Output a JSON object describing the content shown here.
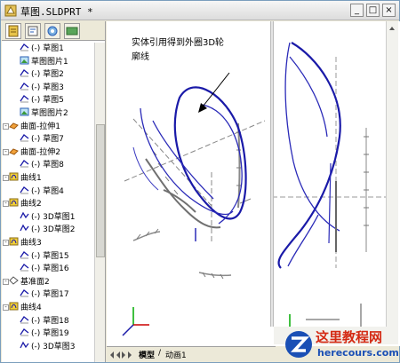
{
  "window": {
    "title": "草图.SLDPRT *",
    "minimize_label": "_",
    "restore_label": "□",
    "close_label": "×"
  },
  "feature_tree": [
    {
      "label": "草图1",
      "prefix": "(-)",
      "icon": "sketch-icon"
    },
    {
      "label": "草图图片1",
      "prefix": "",
      "icon": "sketch-picture-icon"
    },
    {
      "label": "草图2",
      "prefix": "(-)",
      "icon": "sketch-icon"
    },
    {
      "label": "草图3",
      "prefix": "(-)",
      "icon": "sketch-icon"
    },
    {
      "label": "草图5",
      "prefix": "(-)",
      "icon": "sketch-icon"
    },
    {
      "label": "草图图片2",
      "prefix": "",
      "icon": "sketch-picture-icon"
    },
    {
      "label": "曲面-拉伸1",
      "prefix": "",
      "icon": "surface-extrude-icon"
    },
    {
      "label": "草图7",
      "prefix": "(-)",
      "icon": "sketch-icon"
    },
    {
      "label": "曲面-拉伸2",
      "prefix": "",
      "icon": "surface-extrude-icon"
    },
    {
      "label": "草图8",
      "prefix": "(-)",
      "icon": "sketch-icon"
    },
    {
      "label": "曲线1",
      "prefix": "",
      "icon": "curve-icon"
    },
    {
      "label": "草图4",
      "prefix": "(-)",
      "icon": "sketch-icon"
    },
    {
      "label": "曲线2",
      "prefix": "",
      "icon": "curve-icon"
    },
    {
      "label": "3D草图1",
      "prefix": "(-)",
      "icon": "sketch3d-icon"
    },
    {
      "label": "3D草图2",
      "prefix": "(-)",
      "icon": "sketch3d-icon"
    },
    {
      "label": "曲线3",
      "prefix": "",
      "icon": "curve-icon"
    },
    {
      "label": "草图15",
      "prefix": "(-)",
      "icon": "sketch-icon"
    },
    {
      "label": "草图16",
      "prefix": "(-)",
      "icon": "sketch-icon"
    },
    {
      "label": "基准面2",
      "prefix": "",
      "icon": "plane-icon"
    },
    {
      "label": "草图17",
      "prefix": "(-)",
      "icon": "sketch-icon"
    },
    {
      "label": "曲线4",
      "prefix": "",
      "icon": "curve-icon"
    },
    {
      "label": "草图18",
      "prefix": "(-)",
      "icon": "sketch-icon"
    },
    {
      "label": "草图19",
      "prefix": "(-)",
      "icon": "sketch-icon"
    },
    {
      "label": "3D草图3",
      "prefix": "(-)",
      "icon": "sketch3d-icon"
    }
  ],
  "annotation": {
    "line1": "实体引用得到外圈3D轮",
    "line2": "廓线"
  },
  "sheet_tabs": {
    "model": "模型",
    "motion": "动画1"
  },
  "watermark": {
    "name": "这里教程网",
    "site": "herecours.com"
  },
  "colors": {
    "curve_blue": "#1a1aa8",
    "sketch_gray": "#7a7a7a",
    "axis_red": "#cc0000",
    "axis_green": "#00aa00"
  }
}
